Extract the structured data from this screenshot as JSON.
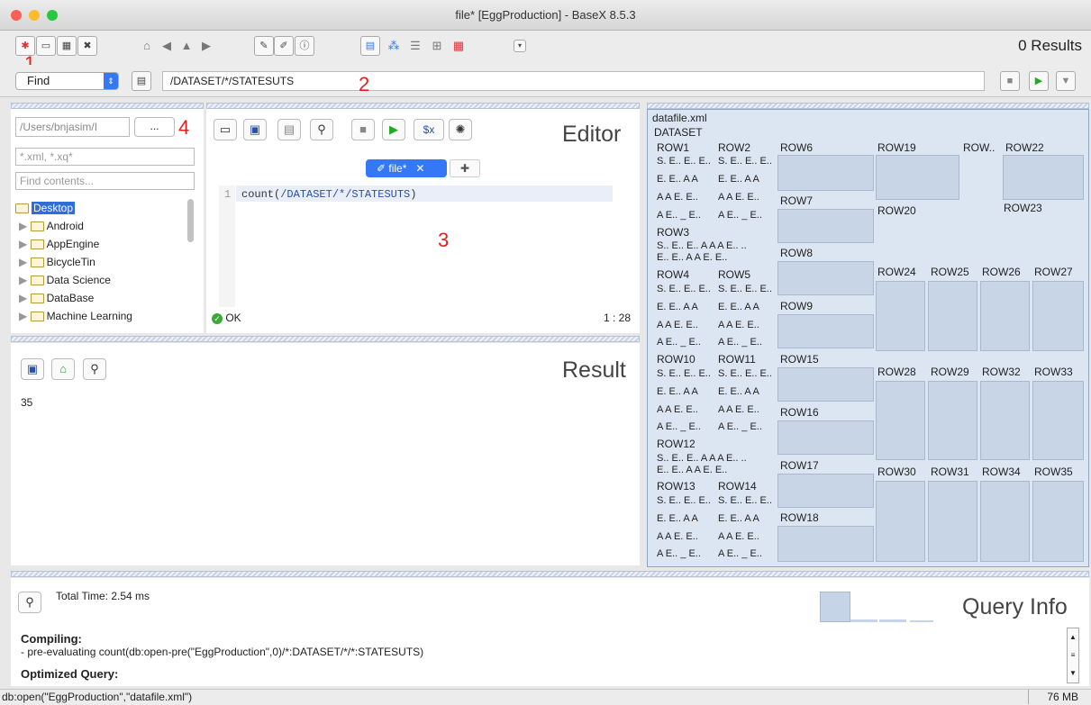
{
  "window": {
    "title": "file* [EggProduction] - BaseX 8.5.3",
    "results_label": "0 Results"
  },
  "annotations": [
    "1",
    "2",
    "3",
    "4"
  ],
  "find": {
    "mode": "Find",
    "query": "/DATASET/*/STATESUTS"
  },
  "files": {
    "path": "/Users/bnjasim/I",
    "browse_label": "...",
    "filter_placeholder": "*.xml, *.xq*",
    "contents_placeholder": "Find contents...",
    "items": [
      "Desktop",
      "Android",
      "AppEngine",
      "BicycleTin",
      "Data Science",
      "DataBase",
      "Machine Learning"
    ]
  },
  "editor": {
    "title": "Editor",
    "tab_label": "file*",
    "line_number": "1",
    "code_prefix": "count(",
    "code_path": "/DATASET/*/STATESUTS",
    "code_suffix": ")",
    "status": "OK",
    "position": "1 : 28"
  },
  "result": {
    "title": "Result",
    "value": "35"
  },
  "map": {
    "file": "datafile.xml",
    "root": "DATASET",
    "rows": [
      "ROW1",
      "ROW2",
      "ROW6",
      "ROW19",
      "ROW..",
      "ROW22",
      "ROW7",
      "ROW20",
      "ROW23",
      "ROW3",
      "ROW8",
      "ROW24",
      "ROW25",
      "ROW26",
      "ROW27",
      "ROW4",
      "ROW5",
      "ROW9",
      "ROW10",
      "ROW11",
      "ROW15",
      "ROW28",
      "ROW29",
      "ROW32",
      "ROW33",
      "ROW16",
      "ROW12",
      "ROW17",
      "ROW30",
      "ROW31",
      "ROW34",
      "ROW35",
      "ROW13",
      "ROW14",
      "ROW18"
    ],
    "cell_lines": {
      "se": "S. E.. E.. E..",
      "eeaa": "E. E.. A A",
      "aaee": "A A E. E..",
      "ae": "A E.. _ E..",
      "sea": "S.. E.. E.. A A A E.. ..",
      "eea": "E.. E.. A A E. E.."
    }
  },
  "query_info": {
    "title": "Query Info",
    "total_time": "Total Time: 2.54 ms",
    "compiling_label": "Compiling:",
    "compiling_text": "- pre-evaluating count(db:open-pre(\"EggProduction\",0)/*:DATASET/*/*:STATESUTS)",
    "optimized_label": "Optimized Query:"
  },
  "status": {
    "text": "db:open(\"EggProduction\",\"datafile.xml\")",
    "memory": "76 MB"
  }
}
